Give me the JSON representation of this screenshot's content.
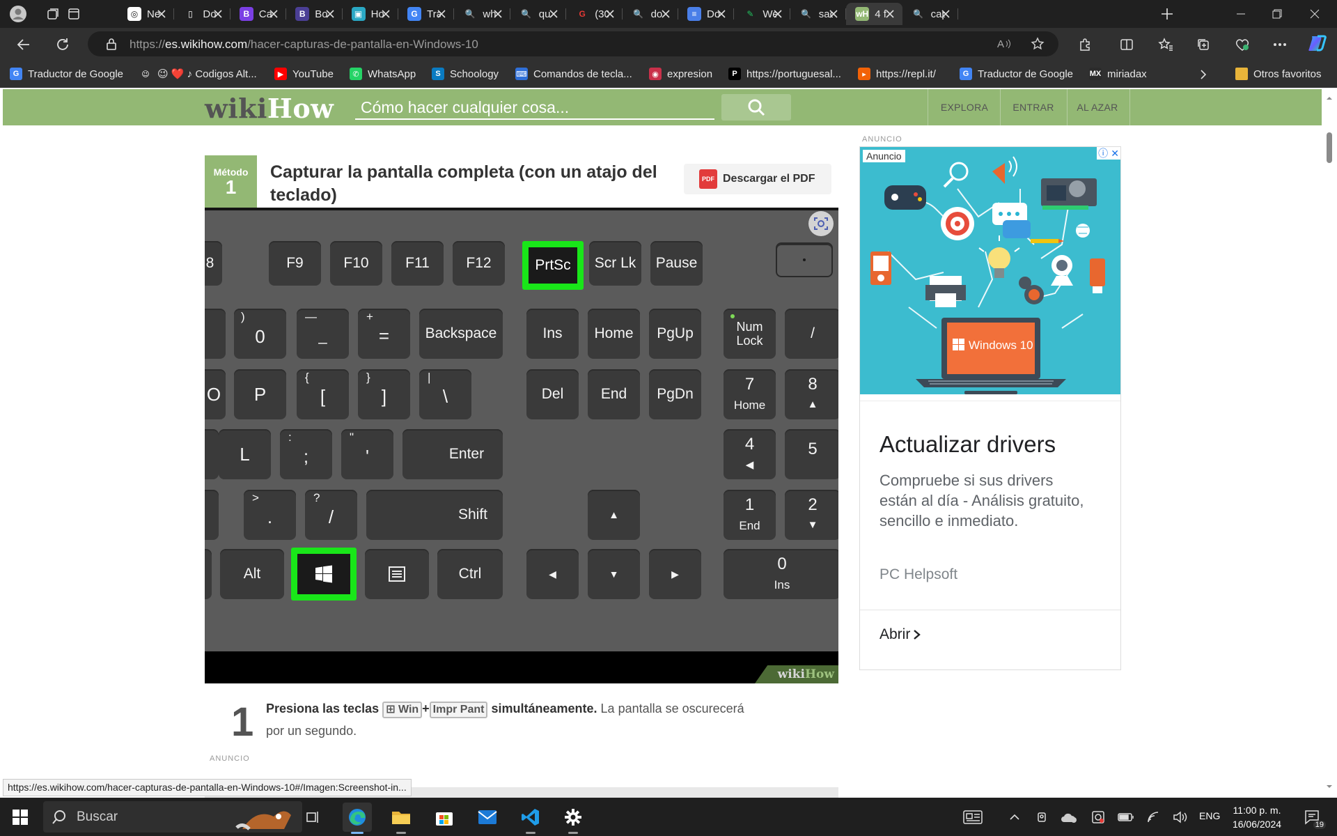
{
  "browser": {
    "tabs": [
      {
        "title": "Ne",
        "fav_color": "#ffffff",
        "fav_text": "◎",
        "fav_fg": "#202020"
      },
      {
        "title": "Do",
        "fav_color": "#202020",
        "fav_text": "▯",
        "fav_fg": "#ffffff"
      },
      {
        "title": "Ca",
        "fav_color": "#7b3fe4",
        "fav_text": "B",
        "fav_fg": "#ffffff"
      },
      {
        "title": "Bo",
        "fav_color": "#4b3f95",
        "fav_text": "B",
        "fav_fg": "#ffffff"
      },
      {
        "title": "Ho",
        "fav_color": "#2aa8c4",
        "fav_text": "▣",
        "fav_fg": "#ffffff"
      },
      {
        "title": "Tra",
        "fav_color": "#4285f4",
        "fav_text": "G",
        "fav_fg": "#ffffff"
      },
      {
        "title": "wh",
        "fav_color": "#202020",
        "fav_text": "🔍",
        "fav_fg": "#4d9fff"
      },
      {
        "title": "qu",
        "fav_color": "#202020",
        "fav_text": "🔍",
        "fav_fg": "#4d9fff"
      },
      {
        "title": "(30",
        "fav_color": "#202020",
        "fav_text": "G",
        "fav_fg": "#e53935"
      },
      {
        "title": "do",
        "fav_color": "#202020",
        "fav_text": "🔍",
        "fav_fg": "#4d9fff"
      },
      {
        "title": "Do",
        "fav_color": "#4a7fe8",
        "fav_text": "≡",
        "fav_fg": "#ffffff"
      },
      {
        "title": "We",
        "fav_color": "#202020",
        "fav_text": "✎",
        "fav_fg": "#21c15f"
      },
      {
        "title": "sac",
        "fav_color": "#202020",
        "fav_text": "🔍",
        "fav_fg": "#4d9fff"
      },
      {
        "title": "4 f",
        "fav_color": "#93b874",
        "fav_text": "wH",
        "fav_fg": "#ffffff",
        "active": true
      },
      {
        "title": "cap",
        "fav_color": "#202020",
        "fav_text": "🔍",
        "fav_fg": "#4d9fff"
      }
    ],
    "url_prefix": "https://",
    "url_domain": "es.wikihow.com",
    "url_path": "/hacer-capturas-de-pantalla-en-Windows-10",
    "bookmarks": [
      {
        "label": "Traductor de Google",
        "icon": "G",
        "color": "#4285f4"
      },
      {
        "label": "😉 ❤️ ♪ Codigos Alt...",
        "icon": "😉",
        "color": "transparent"
      },
      {
        "label": "YouTube",
        "icon": "▶",
        "color": "#ff0000"
      },
      {
        "label": "WhatsApp",
        "icon": "✆",
        "color": "#25d366"
      },
      {
        "label": "Schoology",
        "icon": "S",
        "color": "#0a7bc2"
      },
      {
        "label": "Comandos de tecla...",
        "icon": "⌨",
        "color": "#2f6fd8"
      },
      {
        "label": "expresion",
        "icon": "◉",
        "color": "#c9304a"
      },
      {
        "label": "https://portuguesal...",
        "icon": "P",
        "color": "#000000"
      },
      {
        "label": "https://repl.it/",
        "icon": "▸",
        "color": "#f26207"
      },
      {
        "label": "Traductor de Google",
        "icon": "G",
        "color": "#4285f4"
      },
      {
        "label": "miriadax",
        "icon": "MX",
        "color": "#2b2b2b"
      }
    ],
    "other_favorites": "Otros favoritos",
    "status_url": "https://es.wikihow.com/hacer-capturas-de-pantalla-en-Windows-10#/Imagen:Screenshot-in..."
  },
  "wikihow": {
    "logo_wiki": "wiki",
    "logo_how": "How",
    "search_placeholder": "Cómo hacer cualquier cosa...",
    "nav": [
      "EXPLORA",
      "ENTRAR",
      "AL AZAR"
    ],
    "method_label": "Método",
    "method_number": "1",
    "method_title": "Capturar la pantalla completa (con un atajo del teclado)",
    "pdf_button": "Descargar el PDF",
    "watermark_wiki": "wiki",
    "watermark_how": "How",
    "step_number": "1",
    "step_bold_1": "Presiona las teclas",
    "key_win": "⊞ Win",
    "key_plus": "+",
    "key_prt": "Impr Pant",
    "step_bold_2": "simultáneamente.",
    "step_rest": " La pantalla se oscurecerá por un segundo.",
    "ad_label": "ANUNCIO"
  },
  "keyboard": {
    "row1": [
      "8",
      "F9",
      "F10",
      "F11",
      "F12",
      "PrtSc",
      "Scr Lk",
      "Pause"
    ],
    "row2": [
      ")",
      "0",
      "—",
      "_",
      "+",
      "=",
      "Backspace",
      "Ins",
      "Home",
      "PgUp",
      "Num Lock",
      "/"
    ],
    "row3": [
      "O",
      "P",
      "{",
      "[",
      "}",
      "]",
      "|",
      "\\",
      "Del",
      "End",
      "PgDn",
      "7",
      "Home",
      "8",
      "▲"
    ],
    "row4": [
      "L",
      ":",
      ";",
      "\"",
      "'",
      "Enter",
      "4",
      "◀",
      "5"
    ],
    "row5": [
      ">",
      ".",
      "?",
      "/",
      "Shift",
      "▲",
      "1",
      "End",
      "2",
      "▼"
    ],
    "row6": [
      "Alt",
      "Ctrl",
      "◀",
      "▼",
      "▶",
      "0",
      "Ins"
    ]
  },
  "ad": {
    "chip": "Anuncio",
    "laptop_text": "Windows 10",
    "title": "Actualizar drivers",
    "description": "Compruebe si sus drivers están al día - Análisis gratuito, sencillo e inmediato.",
    "brand": "PC Helpsoft",
    "open": "Abrir"
  },
  "taskbar": {
    "search": "Buscar",
    "lang": "ENG",
    "time": "11:00 p. m.",
    "date": "16/06/2024",
    "notif": "19"
  }
}
